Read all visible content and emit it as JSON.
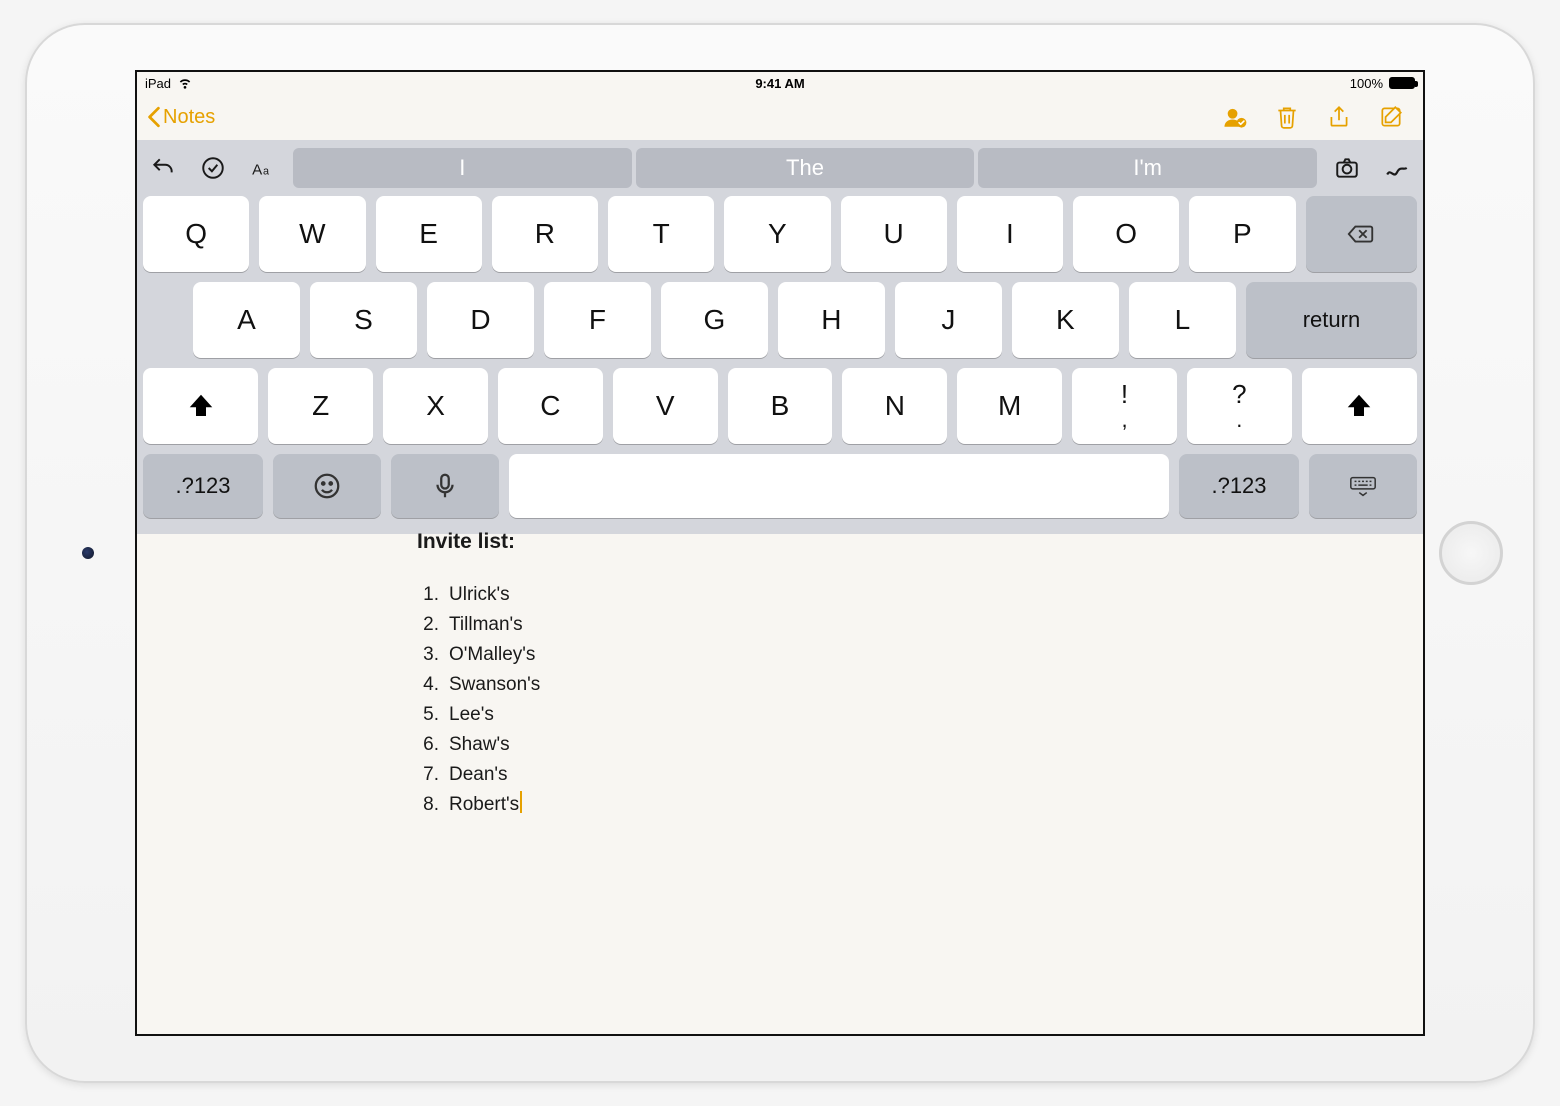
{
  "status": {
    "device": "iPad",
    "time": "9:41 AM",
    "battery_pct": "100%"
  },
  "nav": {
    "back_label": "Notes"
  },
  "keyboard": {
    "suggestions": [
      "I",
      "The",
      "I'm"
    ],
    "row1": [
      "Q",
      "W",
      "E",
      "R",
      "T",
      "Y",
      "U",
      "I",
      "O",
      "P"
    ],
    "row2": [
      "A",
      "S",
      "D",
      "F",
      "G",
      "H",
      "J",
      "K",
      "L"
    ],
    "row3": [
      "Z",
      "X",
      "C",
      "V",
      "B",
      "N",
      "M"
    ],
    "punct1_top": "!",
    "punct1_bot": ",",
    "punct2_top": "?",
    "punct2_bot": ".",
    "return_label": "return",
    "numeric_label": ".?123"
  },
  "note": {
    "heading": "Invite list:",
    "items": [
      "Ulrick's",
      "Tillman's",
      "O'Malley's",
      "Swanson's",
      "Lee's",
      "Shaw's",
      "Dean's",
      "Robert's"
    ]
  }
}
